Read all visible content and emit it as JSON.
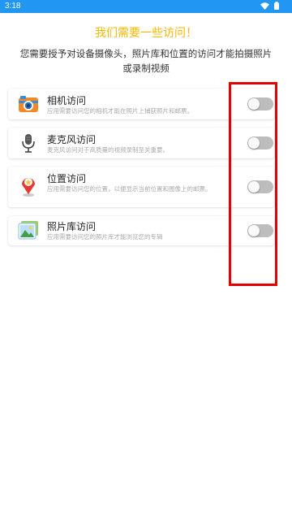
{
  "status_bar": {
    "time": "3:18",
    "bg_color": "#2196f3"
  },
  "header": {
    "title": "我们需要一些访问！",
    "subtitle": "您需要授予对设备摄像头，照片库和位置的访问才能拍摄照片或录制视频",
    "title_color": "#f5b800"
  },
  "permissions": [
    {
      "title": "相机访问",
      "description": "应用需要访问您的相机才能在照片上捕获照片和邮票。",
      "icon": "camera-icon",
      "enabled": false
    },
    {
      "title": "麦克风访问",
      "description": "麦克风访问对于高质量的视频录制至关重要。",
      "icon": "microphone-icon",
      "enabled": false
    },
    {
      "title": "位置访问",
      "description": "应用需要访问您的位置，以便显示当前位置和图像上的邮票。",
      "icon": "location-pin-icon",
      "enabled": false
    },
    {
      "title": "照片库访问",
      "description": "应用需要访问您的照片库才能浏览您的专辑",
      "icon": "photo-gallery-icon",
      "enabled": false
    }
  ],
  "highlight_color": "#e50000"
}
